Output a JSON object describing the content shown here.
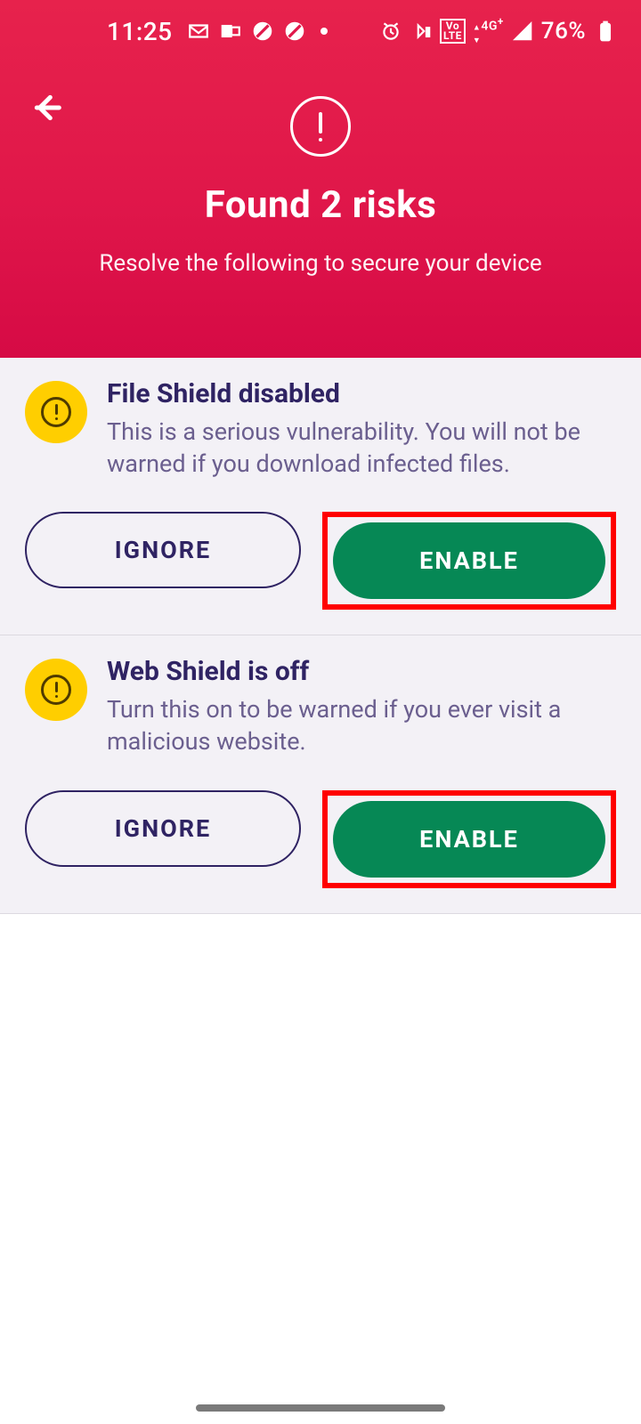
{
  "status": {
    "time": "11:25",
    "battery_pct": "76%",
    "network_label": "4G",
    "volte": "Vo\nLTE",
    "icons": {
      "gmail": "gmail-icon",
      "outlook": "outlook-icon",
      "dnd1": "dnd-icon",
      "dnd2": "dnd-icon",
      "alarm": "alarm-icon",
      "bt": "bluetooth-battery-icon",
      "signal": "signal-icon",
      "battery": "battery-icon"
    }
  },
  "hero": {
    "title": "Found 2 risks",
    "subtitle": "Resolve the following to secure your device"
  },
  "risks": [
    {
      "title": "File Shield disabled",
      "desc": "This is a serious vulnerability. You will not be warned if you download infected files.",
      "ignore": "IGNORE",
      "enable": "ENABLE"
    },
    {
      "title": "Web Shield is off",
      "desc": "Turn this on to be warned if you ever visit a malicious website.",
      "ignore": "IGNORE",
      "enable": "ENABLE"
    }
  ]
}
